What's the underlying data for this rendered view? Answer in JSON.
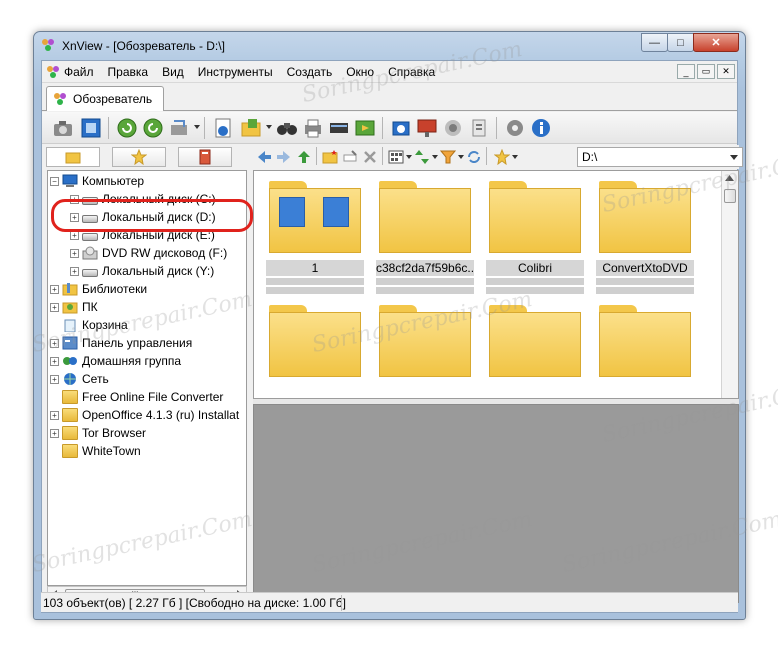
{
  "window": {
    "title": "XnView - [Обозреватель - D:\\]",
    "buttons": {
      "minimize": "—",
      "maximize": "□",
      "close": "✕"
    }
  },
  "menubar": {
    "items": [
      "Файл",
      "Правка",
      "Вид",
      "Инструменты",
      "Создать",
      "Окно",
      "Справка"
    ],
    "mdi_buttons": {
      "minimize": "_",
      "restore": "▭",
      "close": "✕"
    }
  },
  "tab": {
    "label": "Обозреватель"
  },
  "toolbar": {
    "icons": [
      "camera-icon",
      "fullscreen-icon",
      "refresh-ccw-icon",
      "refresh-cw-icon",
      "transfer-icon",
      "file-info-icon",
      "folder-open-icon",
      "binoculars-icon",
      "print-icon",
      "scanner-icon",
      "slideshow-icon",
      "capture-icon",
      "chart-icon",
      "network-icon",
      "tool-icon",
      "settings-icon",
      "info-icon"
    ]
  },
  "navigation": {
    "path": "D:\\"
  },
  "tree": {
    "items": [
      {
        "label": "Компьютер",
        "level": 0,
        "expander": "−",
        "icon": "computer-icon"
      },
      {
        "label": "Локальный диск (C:)",
        "level": 1,
        "expander": "+",
        "icon": "drive-c-icon"
      },
      {
        "label": "Локальный диск (D:)",
        "level": 1,
        "expander": "+",
        "icon": "drive-d-icon"
      },
      {
        "label": "Локальный диск (E:)",
        "level": 1,
        "expander": "+",
        "icon": "drive-e-icon"
      },
      {
        "label": "DVD RW дисковод (F:)",
        "level": 1,
        "expander": "+",
        "icon": "dvd-drive-icon"
      },
      {
        "label": "Локальный диск (Y:)",
        "level": 1,
        "expander": "+",
        "icon": "drive-y-icon"
      },
      {
        "label": "Библиотеки",
        "level": 0,
        "expander": "+",
        "icon": "library-icon"
      },
      {
        "label": "ПК",
        "level": 0,
        "expander": "+",
        "icon": "user-pc-icon"
      },
      {
        "label": "Корзина",
        "level": 0,
        "expander": "",
        "icon": "recycle-bin-icon"
      },
      {
        "label": "Панель управления",
        "level": 0,
        "expander": "+",
        "icon": "control-panel-icon"
      },
      {
        "label": "Домашняя группа",
        "level": 0,
        "expander": "+",
        "icon": "homegroup-icon"
      },
      {
        "label": "Сеть",
        "level": 0,
        "expander": "+",
        "icon": "network-icon"
      },
      {
        "label": "Free Online File Converter",
        "level": 0,
        "expander": "",
        "icon": "folder-icon"
      },
      {
        "label": "OpenOffice 4.1.3 (ru) Installat",
        "level": 0,
        "expander": "+",
        "icon": "folder-icon"
      },
      {
        "label": "Tor Browser",
        "level": 0,
        "expander": "+",
        "icon": "folder-icon"
      },
      {
        "label": "WhiteTown",
        "level": 0,
        "expander": "",
        "icon": "folder-icon"
      }
    ],
    "scroll_thumb": "III"
  },
  "thumbnails": {
    "items": [
      {
        "name": "1"
      },
      {
        "name": "c38cf2da7f59b6c..."
      },
      {
        "name": "Colibri"
      },
      {
        "name": "ConvertXtoDVD"
      },
      {
        "name": ""
      },
      {
        "name": ""
      },
      {
        "name": ""
      },
      {
        "name": ""
      }
    ]
  },
  "statusbar": {
    "text": "103 объект(ов) [ 2.27 Гб ] [Свободно на диске: 1.00 Гб]"
  },
  "watermark": "Soringpcrepair.Com",
  "colors": {
    "highlight": "#e0221c",
    "folder": "#f1c443",
    "preview_bg": "#9a9a9a"
  }
}
